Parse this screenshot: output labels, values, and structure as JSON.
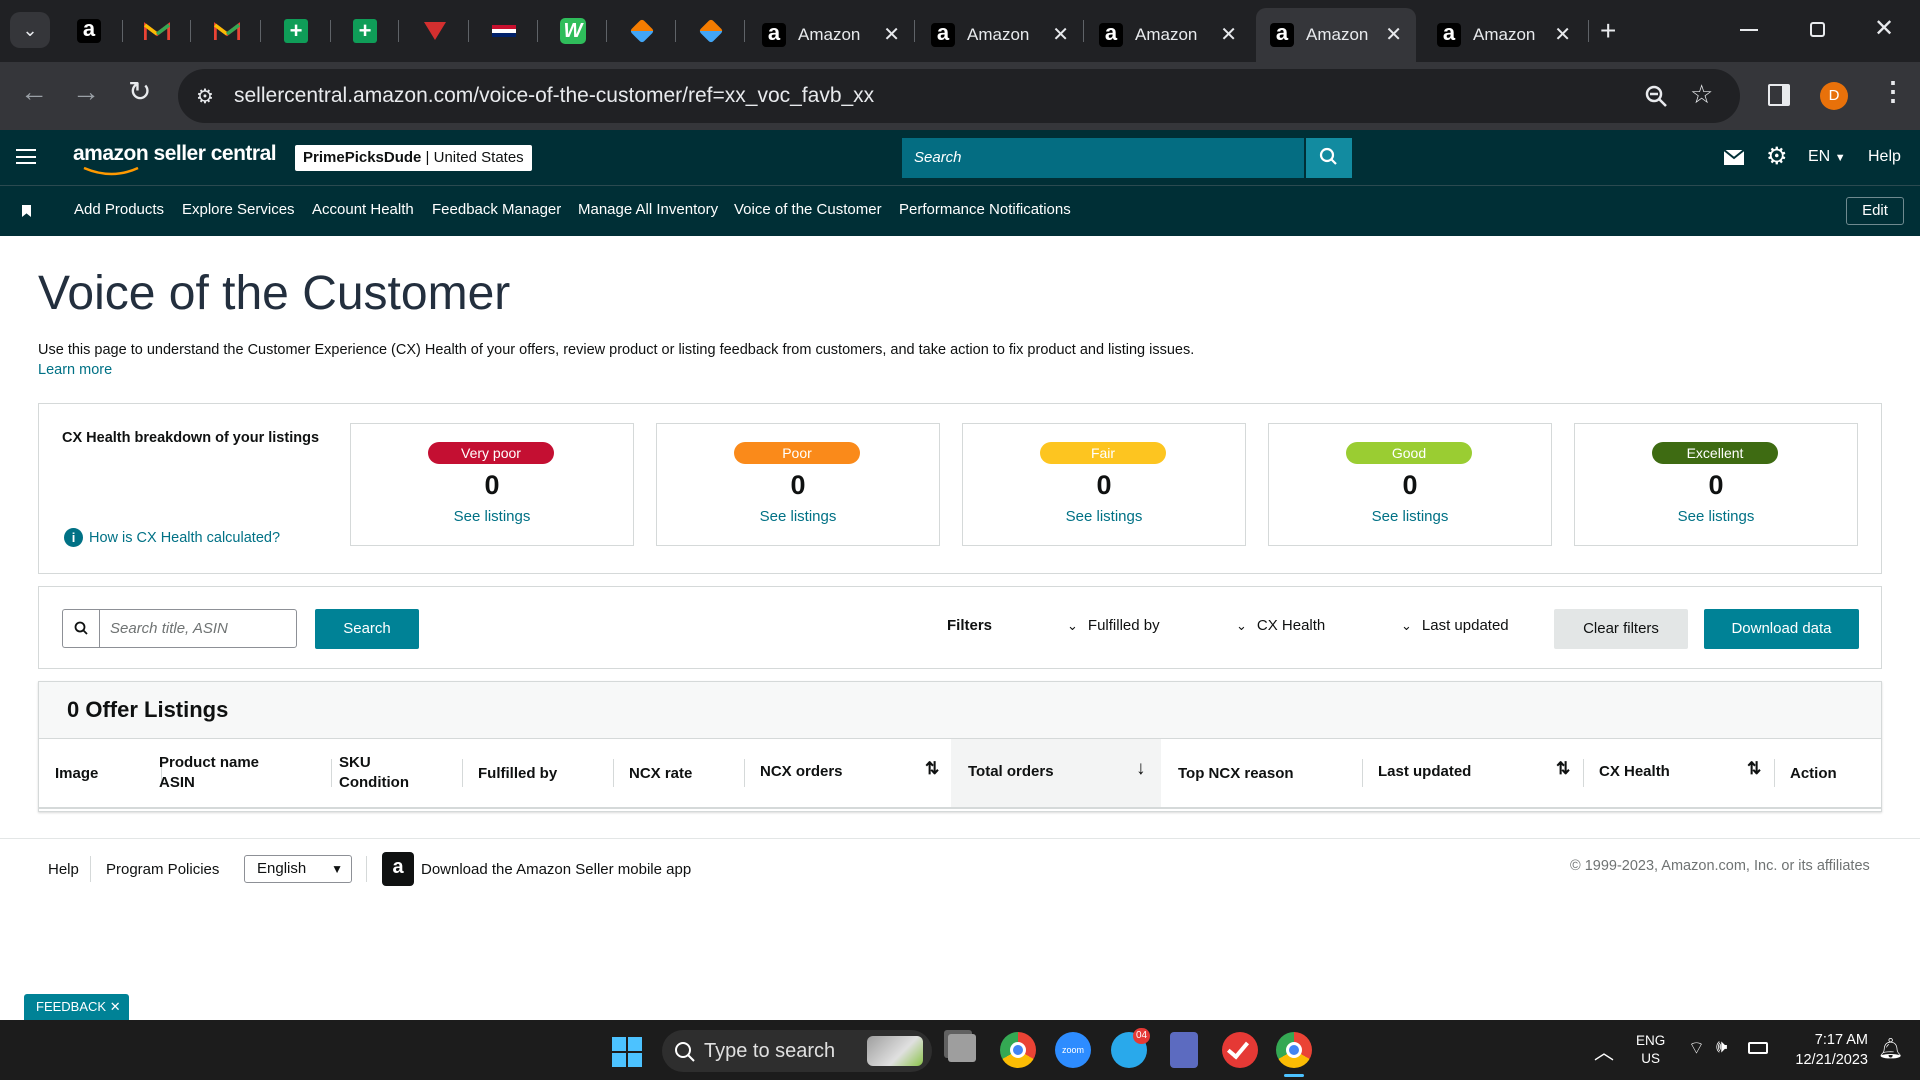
{
  "browser": {
    "tabs": [
      {
        "title": "Amazon"
      },
      {
        "title": "Amazon"
      },
      {
        "title": "Amazon"
      },
      {
        "title": "Amazon"
      },
      {
        "title": "Amazon"
      }
    ],
    "url": "sellercentral.amazon.com/voice-of-the-customer/ref=xx_voc_favb_xx",
    "profile_initial": "D"
  },
  "header": {
    "logo": "amazon seller central",
    "store_name": "PrimePicksDude",
    "store_region": "United States",
    "search_placeholder": "Search",
    "language": "EN",
    "help": "Help"
  },
  "nav": {
    "items": [
      "Add Products",
      "Explore Services",
      "Account Health",
      "Feedback Manager",
      "Manage All Inventory",
      "Voice of the Customer",
      "Performance Notifications"
    ],
    "edit": "Edit"
  },
  "page": {
    "title": "Voice of the Customer",
    "description": "Use this page to understand the Customer Experience (CX) Health of your offers, review product or listing feedback from customers, and take action to fix product and listing issues.",
    "learn_more": "Learn more"
  },
  "cx_health": {
    "heading": "CX Health breakdown of your listings",
    "how_link": "How is CX Health calculated?",
    "cards": [
      {
        "label": "Very poor",
        "count": "0",
        "link": "See listings",
        "color": "#c40f32"
      },
      {
        "label": "Poor",
        "count": "0",
        "link": "See listings",
        "color": "#fa8a1a"
      },
      {
        "label": "Fair",
        "count": "0",
        "link": "See listings",
        "color": "#fdc520"
      },
      {
        "label": "Good",
        "count": "0",
        "link": "See listings",
        "color": "#9acd32"
      },
      {
        "label": "Excellent",
        "count": "0",
        "link": "See listings",
        "color": "#3e6b12"
      }
    ]
  },
  "filters": {
    "search_placeholder": "Search title, ASIN",
    "search_button": "Search",
    "label": "Filters",
    "fulfilled_by": "Fulfilled by",
    "cx_health": "CX Health",
    "last_updated": "Last updated",
    "clear": "Clear filters",
    "download": "Download data"
  },
  "listings": {
    "title": "0 Offer Listings",
    "columns": [
      "Image",
      "Product name",
      "ASIN",
      "SKU",
      "Condition",
      "Fulfilled by",
      "NCX rate",
      "NCX orders",
      "Total orders",
      "Top NCX reason",
      "Last updated",
      "CX Health",
      "Action"
    ]
  },
  "footer": {
    "help": "Help",
    "policies": "Program Policies",
    "language": "English",
    "app": "Download the Amazon Seller mobile app",
    "copyright": "© 1999-2023, Amazon.com, Inc. or its affiliates"
  },
  "feedback": "FEEDBACK",
  "taskbar": {
    "search": "Type to search",
    "lang": "ENG",
    "region": "US",
    "time": "7:17 AM",
    "date": "12/21/2023",
    "telegram_badge": "04",
    "zoom_label": "zoom"
  },
  "colors": {
    "seller_header": "#002f36",
    "accent": "#007185",
    "primary_button": "#008296"
  }
}
